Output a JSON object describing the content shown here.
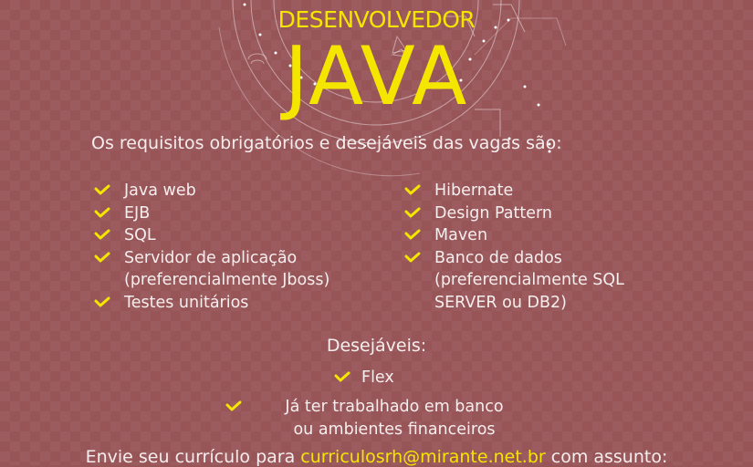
{
  "colors": {
    "background": "#985558",
    "accent": "#f5e600",
    "text": "#f6eeee"
  },
  "header": {
    "subtitle": "DESENVOLVEDOR",
    "title": "JAVA"
  },
  "intro": "Os requisitos obrigatórios e desejáveis das vagas são:",
  "requirements_left": [
    {
      "icon": "check-icon",
      "lines": [
        "Java web"
      ]
    },
    {
      "icon": "check-icon",
      "lines": [
        "EJB"
      ]
    },
    {
      "icon": "check-icon",
      "lines": [
        "SQL"
      ]
    },
    {
      "icon": "check-icon",
      "lines": [
        "Servidor de aplicação",
        "(preferencialmente Jboss)"
      ]
    },
    {
      "icon": "check-icon",
      "lines": [
        "Testes unitários"
      ]
    }
  ],
  "requirements_right": [
    {
      "icon": "check-icon",
      "lines": [
        "Hibernate"
      ]
    },
    {
      "icon": "check-icon",
      "lines": [
        "Design Pattern"
      ]
    },
    {
      "icon": "check-icon",
      "lines": [
        "Maven"
      ]
    },
    {
      "icon": "check-icon",
      "lines": [
        "Banco de dados",
        "(preferencialmente SQL",
        "SERVER ou DB2)"
      ]
    }
  ],
  "desirable": {
    "title": "Desejáveis:",
    "items": [
      {
        "icon": "check-icon",
        "lines": [
          "Flex"
        ]
      },
      {
        "icon": "check-icon",
        "lines": [
          "Já ter trabalhado em banco",
          "ou ambientes financeiros"
        ]
      }
    ]
  },
  "footer": {
    "prefix": "Envie seu currículo para",
    "email": "curriculosrh@mirante.net.br",
    "suffix": "com assunto:"
  }
}
